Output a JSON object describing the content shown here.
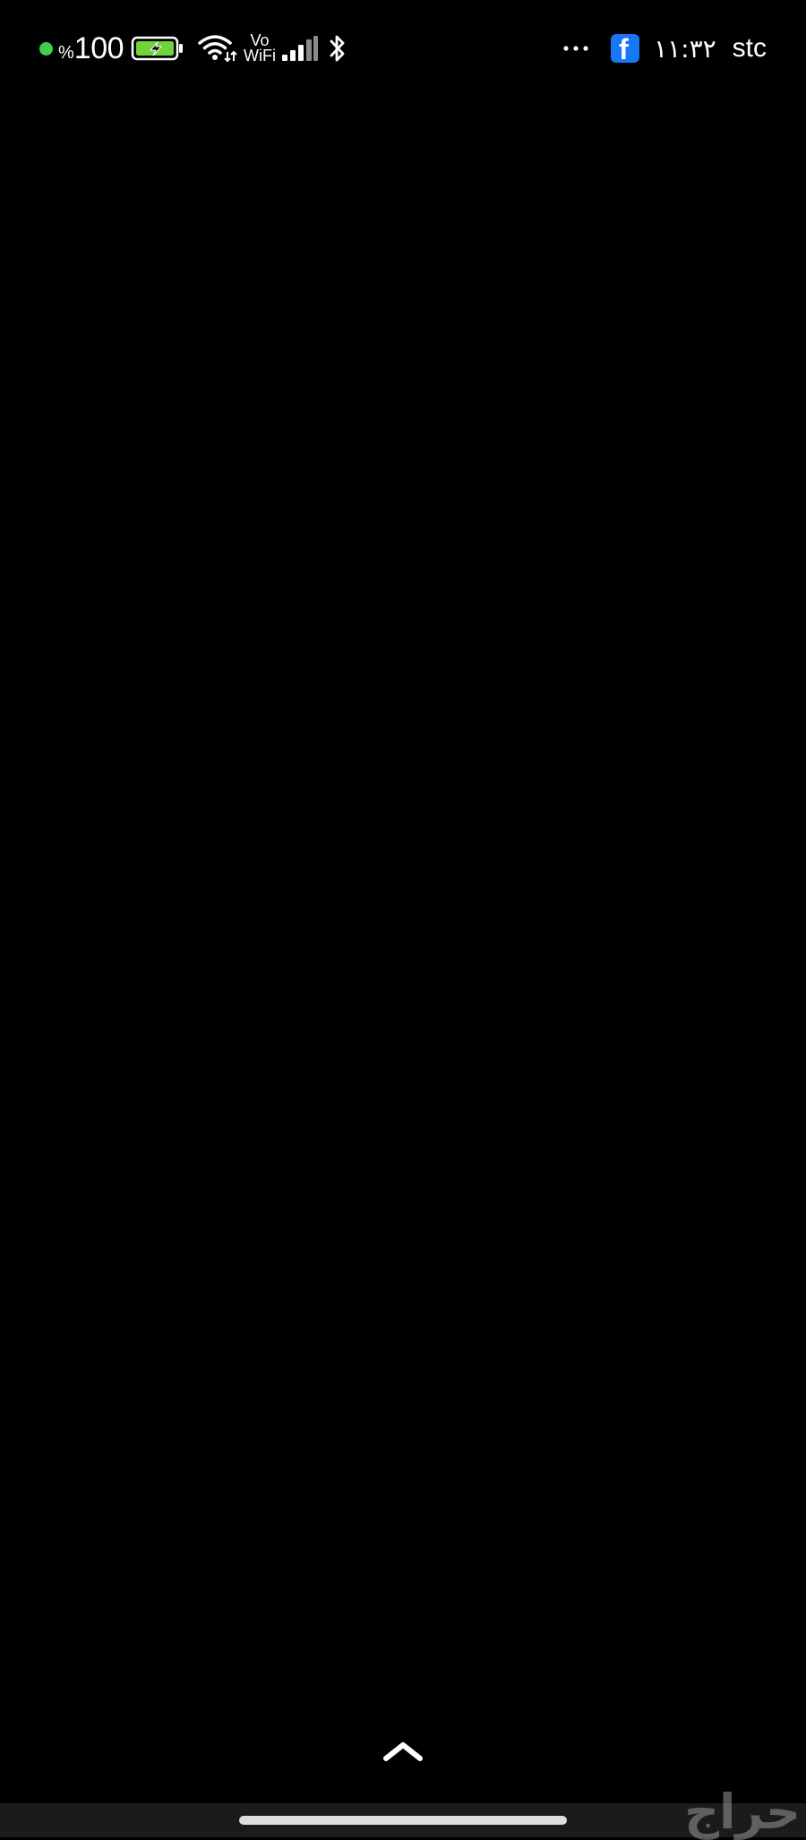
{
  "status_bar": {
    "battery_percent_sign": "%",
    "battery_level": "100",
    "vowifi_top": "Vo",
    "vowifi_bottom": "WiFi",
    "clock": "١١:٣٢",
    "carrier": "stc",
    "notification_app_icon": "facebook-icon",
    "fb_letter": "f",
    "icons": [
      "privacy-dot",
      "battery-charging-icon",
      "wifi-icon",
      "signal-icon",
      "bluetooth-icon",
      "more-icon",
      "facebook-icon"
    ]
  },
  "colors": {
    "background": "#000000",
    "privacy_dot": "#3ecf4c",
    "battery_fill": "#6fd43a",
    "facebook_blue": "#1877f2",
    "foreground": "#ffffff",
    "bottom_strip": "#1b1b1b"
  },
  "navigation": {
    "swipe_up_icon": "chevron-up-icon",
    "home_indicator_icon": "home-indicator"
  },
  "watermark": {
    "text": "حراج"
  }
}
